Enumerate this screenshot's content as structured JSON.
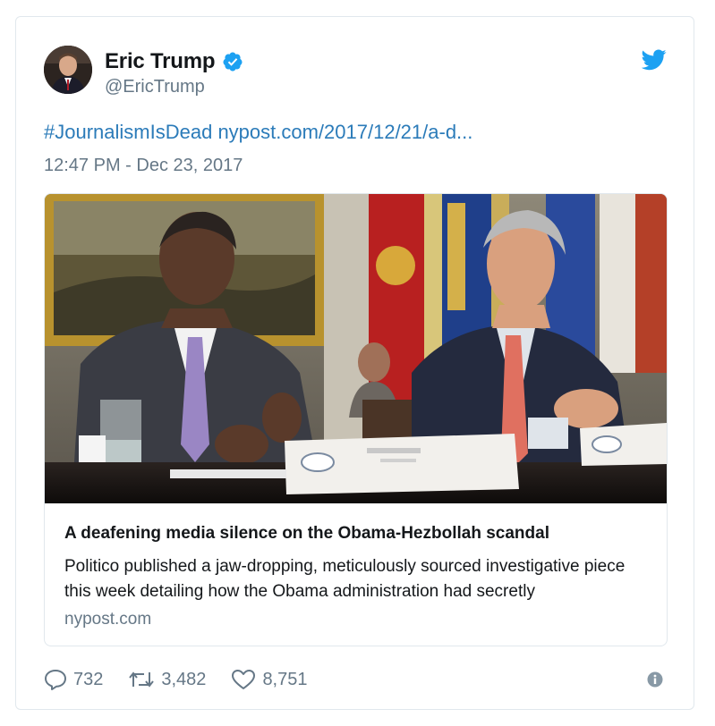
{
  "tweet": {
    "author": {
      "display_name": "Eric Trump",
      "handle": "@EricTrump",
      "verified": true
    },
    "text": {
      "hashtag": "#JournalismIsDead",
      "link": "nypost.com/2017/12/21/a-d..."
    },
    "timestamp": "12:47 PM - Dec 23, 2017",
    "card": {
      "title": "A deafening media silence on the Obama-Hezbollah scandal",
      "description": "Politico published a jaw-dropping, meticulously sourced investigative piece this week detailing how the Obama administration had secretly",
      "domain": "nypost.com"
    },
    "actions": {
      "replies": "732",
      "retweets": "3,482",
      "likes": "8,751"
    }
  },
  "colors": {
    "brand_blue": "#1da1f2",
    "link_blue": "#2b7bb9",
    "secondary_text": "#657786",
    "border": "#e1e8ed"
  },
  "icons": {
    "bird": "twitter-bird-icon",
    "verified": "verified-badge-icon",
    "reply": "reply-icon",
    "retweet": "retweet-icon",
    "like": "heart-icon",
    "info": "info-icon"
  }
}
